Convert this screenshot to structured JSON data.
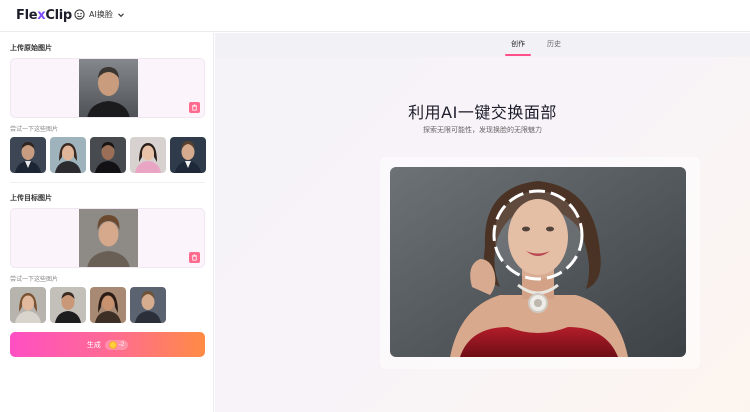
{
  "app": {
    "logo_flex": "Fle",
    "logo_x": "x",
    "logo_clip": "Clip",
    "tool_name": "AI换脸"
  },
  "sidebar": {
    "upload_original_title": "上传原始图片",
    "try_original_hint": "尝试一下这些图片",
    "upload_target_title": "上传目标图片",
    "try_target_hint": "尝试一下这些图片",
    "generate_label": "生成",
    "credit_cost": "-2"
  },
  "main": {
    "tabs": [
      {
        "label": "创作",
        "active": true
      },
      {
        "label": "历史",
        "active": false
      }
    ],
    "headline": "利用AI一键交换面部",
    "subline": "探索无限可能性，发现换脸的无限魅力"
  },
  "colors": {
    "accent_pink": "#ff4f8b",
    "button_gradient_start": "#ff4fc3",
    "button_gradient_end": "#ff8b44",
    "delete_icon_bg": "#ff6b8e"
  }
}
